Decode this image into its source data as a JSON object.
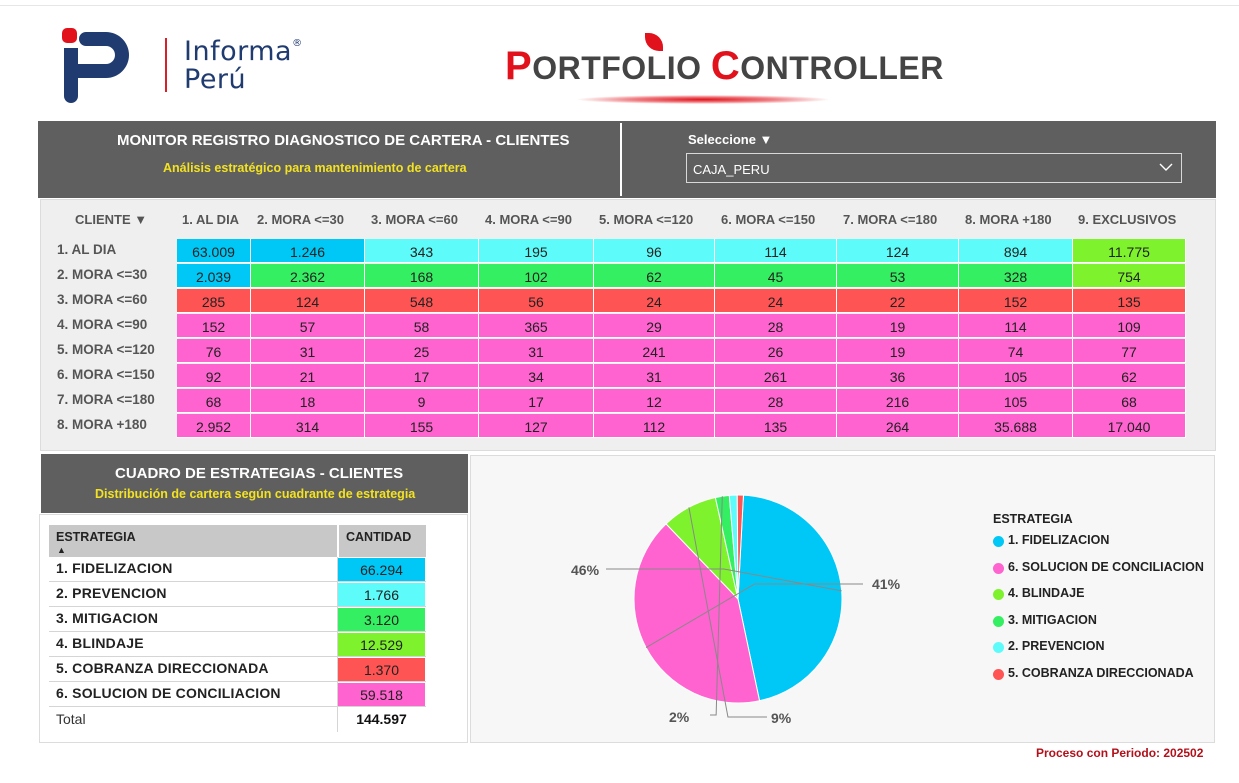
{
  "brand": {
    "name_line1": "Informa",
    "name_line2": "Perú",
    "registered": "®"
  },
  "title": {
    "first_cap": "P",
    "first_rest": "ORTFOLIO",
    "second_cap": "C",
    "second_rest": "ONTROLLER"
  },
  "monitor": {
    "title": "MONITOR REGISTRO DIAGNOSTICO DE CARTERA - CLIENTES",
    "subtitle": "Análisis estratégico para mantenimiento de cartera"
  },
  "selector": {
    "label": "Seleccione ▼",
    "value": "CAJA_PERU"
  },
  "matrix": {
    "corner_header": "CLIENTE ▼",
    "columns": [
      "1. AL DIA",
      "2. MORA <=30",
      "3. MORA <=60",
      "4. MORA <=90",
      "5. MORA <=120",
      "6. MORA <=150",
      "7. MORA <=180",
      "8. MORA +180",
      "9. EXCLUSIVOS"
    ],
    "rows": [
      {
        "label": "1. AL DIA",
        "values": [
          "63.009",
          "1.246",
          "343",
          "195",
          "96",
          "114",
          "124",
          "894",
          "11.775"
        ],
        "colors": [
          "#00c8f6",
          "#00c8f6",
          "#5dfcfa",
          "#5dfcfa",
          "#5dfcfa",
          "#5dfcfa",
          "#5dfcfa",
          "#5dfcfa",
          "#7ff22e"
        ]
      },
      {
        "label": "2. MORA <=30",
        "values": [
          "2.039",
          "2.362",
          "168",
          "102",
          "62",
          "45",
          "53",
          "328",
          "754"
        ],
        "colors": [
          "#00c8f6",
          "#35ef62",
          "#35ef62",
          "#35ef62",
          "#35ef62",
          "#35ef62",
          "#35ef62",
          "#35ef62",
          "#7ff22e"
        ]
      },
      {
        "label": "3. MORA <=60",
        "values": [
          "285",
          "124",
          "548",
          "56",
          "24",
          "24",
          "22",
          "152",
          "135"
        ],
        "colors": [
          "#ff5454",
          "#ff5454",
          "#ff5454",
          "#ff5454",
          "#ff5454",
          "#ff5454",
          "#ff5454",
          "#ff5454",
          "#ff5454"
        ]
      },
      {
        "label": "4. MORA <=90",
        "values": [
          "152",
          "57",
          "58",
          "365",
          "29",
          "28",
          "19",
          "114",
          "109"
        ],
        "colors": [
          "#ff63cf",
          "#ff63cf",
          "#ff63cf",
          "#ff63cf",
          "#ff63cf",
          "#ff63cf",
          "#ff63cf",
          "#ff63cf",
          "#ff63cf"
        ]
      },
      {
        "label": "5. MORA <=120",
        "values": [
          "76",
          "31",
          "25",
          "31",
          "241",
          "26",
          "19",
          "74",
          "77"
        ],
        "colors": [
          "#ff63cf",
          "#ff63cf",
          "#ff63cf",
          "#ff63cf",
          "#ff63cf",
          "#ff63cf",
          "#ff63cf",
          "#ff63cf",
          "#ff63cf"
        ]
      },
      {
        "label": "6. MORA <=150",
        "values": [
          "92",
          "21",
          "17",
          "34",
          "31",
          "261",
          "36",
          "105",
          "62"
        ],
        "colors": [
          "#ff63cf",
          "#ff63cf",
          "#ff63cf",
          "#ff63cf",
          "#ff63cf",
          "#ff63cf",
          "#ff63cf",
          "#ff63cf",
          "#ff63cf"
        ]
      },
      {
        "label": "7. MORA <=180",
        "values": [
          "68",
          "18",
          "9",
          "17",
          "12",
          "28",
          "216",
          "105",
          "68"
        ],
        "colors": [
          "#ff63cf",
          "#ff63cf",
          "#ff63cf",
          "#ff63cf",
          "#ff63cf",
          "#ff63cf",
          "#ff63cf",
          "#ff63cf",
          "#ff63cf"
        ]
      },
      {
        "label": "8. MORA +180",
        "values": [
          "2.952",
          "314",
          "155",
          "127",
          "112",
          "135",
          "264",
          "35.688",
          "17.040"
        ],
        "colors": [
          "#ff63cf",
          "#ff63cf",
          "#ff63cf",
          "#ff63cf",
          "#ff63cf",
          "#ff63cf",
          "#ff63cf",
          "#ff63cf",
          "#ff63cf"
        ]
      }
    ]
  },
  "strategies": {
    "title": "CUADRO DE ESTRATEGIAS - CLIENTES",
    "subtitle": "Distribución de cartera según cuadrante de estrategia",
    "col_strategy": "ESTRATEGIA",
    "col_amount": "CANTIDAD",
    "sort_icon": "▲",
    "rows": [
      {
        "label": "1. FIDELIZACION",
        "value": "66.294",
        "color": "#00c8f6"
      },
      {
        "label": "2. PREVENCION",
        "value": "1.766",
        "color": "#5dfcfa"
      },
      {
        "label": "3. MITIGACION",
        "value": "3.120",
        "color": "#35ef62"
      },
      {
        "label": "4. BLINDAJE",
        "value": "12.529",
        "color": "#7ff22e"
      },
      {
        "label": "5. COBRANZA DIRECCIONADA",
        "value": "1.370",
        "color": "#ff5454"
      },
      {
        "label": "6. SOLUCION DE CONCILIACION",
        "value": "59.518",
        "color": "#ff63cf"
      }
    ],
    "total_label": "Total",
    "total_value": "144.597"
  },
  "chart_data": {
    "type": "pie",
    "legend_title": "ESTRATEGIA",
    "legend_placement": "right",
    "slices": [
      {
        "name": "1. FIDELIZACION",
        "value": 66294,
        "color": "#00c8f6"
      },
      {
        "name": "6. SOLUCION DE CONCILIACION",
        "value": 59518,
        "color": "#ff63cf"
      },
      {
        "name": "4. BLINDAJE",
        "value": 12529,
        "color": "#7ff22e"
      },
      {
        "name": "3. MITIGACION",
        "value": 3120,
        "color": "#35ef62"
      },
      {
        "name": "2. PREVENCION",
        "value": 1766,
        "color": "#5dfcfa"
      },
      {
        "name": "5. COBRANZA DIRECCIONADA",
        "value": 1370,
        "color": "#ff5454"
      }
    ],
    "data_labels": [
      "46%",
      "41%",
      "9%",
      "2%"
    ]
  },
  "footer": {
    "period_text": "Proceso con Periodo: 202502"
  }
}
